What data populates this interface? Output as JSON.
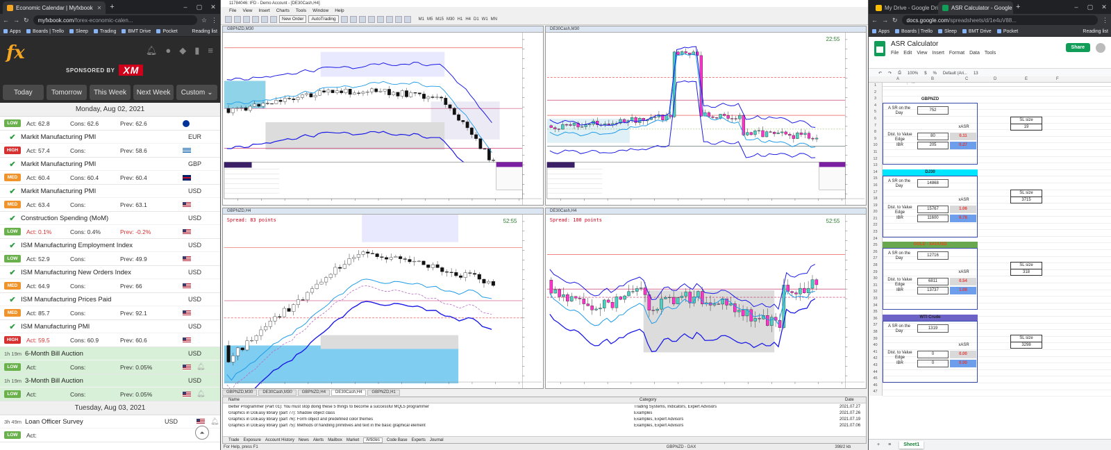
{
  "left_browser": {
    "tabs": [
      {
        "title": "Economic Calendar | Myfxbook",
        "active": true
      }
    ],
    "address": {
      "host": "myfxbook.com",
      "path": "/forex-economic-calen..."
    },
    "bookmarks": [
      "Apps",
      "Boards | Trello",
      "Sleep",
      "Trading",
      "BMT Drive",
      "Pocket"
    ],
    "bookmarks_right": "Reading list",
    "sponsor_text": "SPONSORED BY",
    "sponsor_brand": "XM",
    "logo": "fx",
    "filter_tabs": [
      "Today",
      "Tomorrow",
      "This Week",
      "Next Week",
      "Custom"
    ],
    "day1": "Monday, Aug 02, 2021",
    "day2": "Tuesday, Aug 03, 2021",
    "events": [
      {
        "impact": "LOW",
        "act": "Act: 62.8",
        "cons": "Cons: 62.6",
        "prev": "Prev: 62.6",
        "next_name": "Markit Manufacturing PMI",
        "next_cur": "EUR"
      },
      {
        "impact": "HIGH",
        "act": "Act: 57.4",
        "cons": "Cons:",
        "prev": "Prev: 58.6",
        "next_name": "Markit Manufacturing PMI",
        "next_cur": "GBP"
      },
      {
        "impact": "MED",
        "act": "Act: 60.4",
        "cons": "Cons: 60.4",
        "prev": "Prev: 60.4",
        "next_name": "Markit Manufacturing PMI",
        "next_cur": "USD"
      },
      {
        "impact": "MED",
        "act": "Act: 63.4",
        "cons": "Cons:",
        "prev": "Prev: 63.1",
        "next_name": "Construction Spending (MoM)",
        "next_cur": "USD"
      },
      {
        "impact": "LOW",
        "act": "Act: 0.1%",
        "cons": "Cons: 0.4%",
        "prev": "Prev: -0.2%",
        "next_name": "ISM Manufacturing Employment Index",
        "next_cur": "USD"
      },
      {
        "impact": "LOW",
        "act": "Act: 52.9",
        "cons": "Cons:",
        "prev": "Prev: 49.9",
        "next_name": "ISM Manufacturing New Orders Index",
        "next_cur": "USD"
      },
      {
        "impact": "MED",
        "act": "Act: 64.9",
        "cons": "Cons:",
        "prev": "Prev: 66",
        "next_name": "ISM Manufacturing Prices Paid",
        "next_cur": "USD"
      },
      {
        "impact": "MED",
        "act": "Act: 85.7",
        "cons": "Cons:",
        "prev": "Prev: 92.1",
        "next_name": "ISM Manufacturing PMI",
        "next_cur": "USD"
      },
      {
        "impact": "HIGH",
        "act": "Act: 59.5",
        "cons": "Cons: 60.9",
        "prev": "Prev: 60.6"
      }
    ],
    "upcoming": [
      {
        "time": "1h 19m",
        "name": "6-Month Bill Auction",
        "cur": "USD",
        "impact": "LOW",
        "act": "Act:",
        "cons": "Cons:",
        "prev": "Prev: 0.05%"
      },
      {
        "time": "1h 19m",
        "name": "3-Month Bill Auction",
        "cur": "USD",
        "impact": "LOW",
        "act": "Act:",
        "cons": "Cons:",
        "prev": "Prev: 0.05%"
      }
    ],
    "tuesday_first": {
      "time": "3h 49m",
      "name": "Loan Officer Survey",
      "cur": "USD",
      "impact": "LOW",
      "act": "Act:"
    }
  },
  "mt4": {
    "title": "11784046: IFD - Demo Account - [DE30Cash,H4]",
    "menu": [
      "File",
      "View",
      "Insert",
      "Charts",
      "Tools",
      "Window",
      "Help"
    ],
    "new_order": "New Order",
    "auto_trading": "AutoTrading",
    "timeframes": [
      "M1",
      "M5",
      "M15",
      "M30",
      "H1",
      "H4",
      "D1",
      "W1",
      "MN"
    ],
    "charts": [
      {
        "title": "GBPNZD,M30",
        "overlay": "",
        "clock": ""
      },
      {
        "title": "DE30Cash,M30",
        "overlay": "",
        "clock": "22:55"
      },
      {
        "title": "GBPNZD,H4",
        "overlay": "Spread: 83 points",
        "clock": "52:55"
      },
      {
        "title": "DE30Cash,H4",
        "overlay": "Spread: 100 points",
        "clock": "52:55"
      }
    ],
    "chart_tabs": [
      "GBPNZD,M30",
      "DE30Cash,M30",
      "GBPNZD,H4",
      "DE30Cash,H4",
      "GBPNZD,H1"
    ],
    "terminal_headers": {
      "name": "Name",
      "category": "Category",
      "date": "Date"
    },
    "articles": [
      {
        "name": "Better Programmer (Part 01): You must stop doing these 5 things to become a successful MQL5 programmer",
        "category": "Trading Systems, Indicators, Expert Advisors",
        "date": "2021.07.27"
      },
      {
        "name": "Graphics in DoEasy library (part 77): Shadow object class",
        "category": "Examples",
        "date": "2021.07.26"
      },
      {
        "name": "Graphics in DoEasy library (part 76): Form object and predefined color themes",
        "category": "Examples, Expert Advisors",
        "date": "2021.07.19"
      },
      {
        "name": "Graphics in DoEasy library (part 75): Methods of handling primitives and text in the basic graphical element",
        "category": "Examples, Expert Advisors",
        "date": "2021.07.06"
      }
    ],
    "terminal_tabs": [
      "Trade",
      "Exposure",
      "Account History",
      "News",
      "Alerts",
      "Mailbox",
      "Market",
      "Articles",
      "Code Base",
      "Experts",
      "Journal"
    ],
    "status_left": "For Help, press F1",
    "status_mid": "GBPNZD - DAX",
    "status_right": "398/2 kb"
  },
  "right_browser": {
    "tabs": [
      {
        "title": "My Drive - Google Drive",
        "active": false
      },
      {
        "title": "ASR Calculator - Google Sh",
        "active": true
      }
    ],
    "address": {
      "host": "docs.google.com",
      "path": "/spreadsheets/d/1e4uV88..."
    },
    "bookmarks": [
      "Apps",
      "Boards | Trello",
      "Sleep",
      "BMT Drive",
      "Pocket"
    ],
    "bookmarks_right": "Reading list",
    "doc_title": "ASR Calculator",
    "menu": [
      "File",
      "Edit",
      "View",
      "Insert",
      "Format",
      "Data",
      "Tools"
    ],
    "share": "Share",
    "zoom": "100%",
    "font": "Default (Ari...",
    "font_size": "13",
    "cell_ref": "A1",
    "columns": [
      "A",
      "B",
      "C",
      "D",
      "E",
      "F"
    ],
    "sheet_tab": "Sheet1",
    "blocks": [
      {
        "name": "GBPNZD",
        "asr_label": "A SR on the Day",
        "asr": "752",
        "xasr": "xASR",
        "dist_label": "Dist. to Value Edge",
        "dist": "80",
        "dist_x": "0.11",
        "ibr_label": "IBR",
        "ibr": "205",
        "ibr_x": "0.27",
        "sl_label": "SL size",
        "sl": "19",
        "header_color": "#ffffff"
      },
      {
        "name": "DJ30",
        "asr_label": "A SR on the Day",
        "asr": "14868",
        "xasr": "xASR",
        "dist_label": "Dist. to Value Edge",
        "dist": "15767",
        "dist_x": "1.06",
        "ibr_label": "IBR",
        "ibr": "11600",
        "ibr_x": "0.78",
        "sl_label": "SL size",
        "sl": "3715",
        "header_color": "#00e5ff"
      },
      {
        "name": "GOLD - XAUUSD",
        "asr_label": "A SR on the Day",
        "asr": "12716",
        "xasr": "xASR",
        "dist_label": "Dist. to Value Edge",
        "dist": "6811",
        "dist_x": "0.54",
        "ibr_label": "IBR",
        "ibr": "13737",
        "ibr_x": "1.08",
        "sl_label": "SL size",
        "sl": "318",
        "header_color": "#6aa84f"
      },
      {
        "name": "WTI Crude",
        "asr_label": "A SR on the Day",
        "asr": "1319",
        "xasr": "xASR",
        "dist_label": "Dist. to Value Edge",
        "dist": "0",
        "dist_x": "0.00",
        "ibr_label": "IBR",
        "ibr": "0",
        "ibr_x": "0.00",
        "sl_label": "SL size",
        "sl": "3298",
        "header_color": "#6d63c6"
      }
    ]
  },
  "colors": {
    "bull_candle": "#4dd0c4",
    "bear_candle": "#ff33cc",
    "ma_blue": "#1a1ae6",
    "ma_light": "#1e9be8"
  }
}
